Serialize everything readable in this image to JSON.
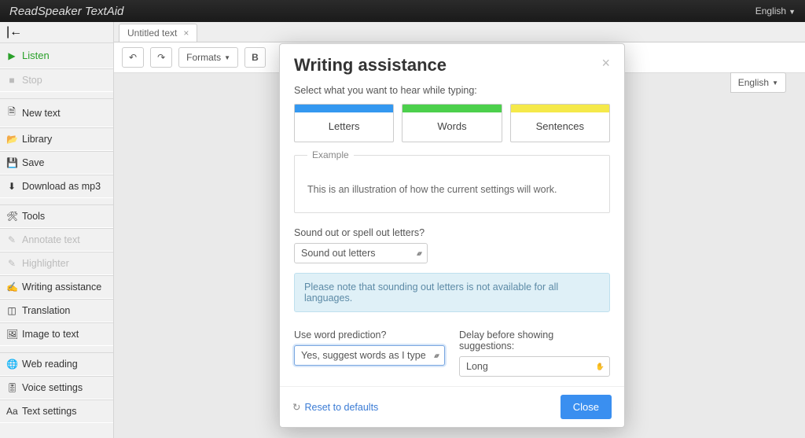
{
  "topbar": {
    "brand": "ReadSpeaker TextAid",
    "language": "English"
  },
  "sidebar": {
    "collapse_icon": "|←",
    "listen": "Listen",
    "stop": "Stop",
    "new_text": "New text",
    "library": "Library",
    "save": "Save",
    "download": "Download as mp3",
    "tools": "Tools",
    "annotate": "Annotate text",
    "highlighter": "Highlighter",
    "writing": "Writing assistance",
    "translation": "Translation",
    "image_to_text": "Image to text",
    "web_reading": "Web reading",
    "voice_settings": "Voice settings",
    "text_settings": "Text settings"
  },
  "tabs": {
    "tab1": "Untitled text"
  },
  "toolbar": {
    "formats": "Formats",
    "bold": "B",
    "english": "English"
  },
  "modal": {
    "title": "Writing assistance",
    "instruction": "Select what you want to hear while typing:",
    "opt_letters": "Letters",
    "opt_words": "Words",
    "opt_sentences": "Sentences",
    "example_legend": "Example",
    "example_text": "This is an illustration of how the current settings will work.",
    "sound_label": "Sound out or spell out letters?",
    "sound_value": "Sound out letters",
    "notice": "Please note that sounding out letters is not available for all languages.",
    "predict_label": "Use word prediction?",
    "predict_value": "Yes, suggest words as I type",
    "delay_label": "Delay before showing suggestions:",
    "delay_value": "Long",
    "reset": "Reset to defaults",
    "close": "Close"
  }
}
